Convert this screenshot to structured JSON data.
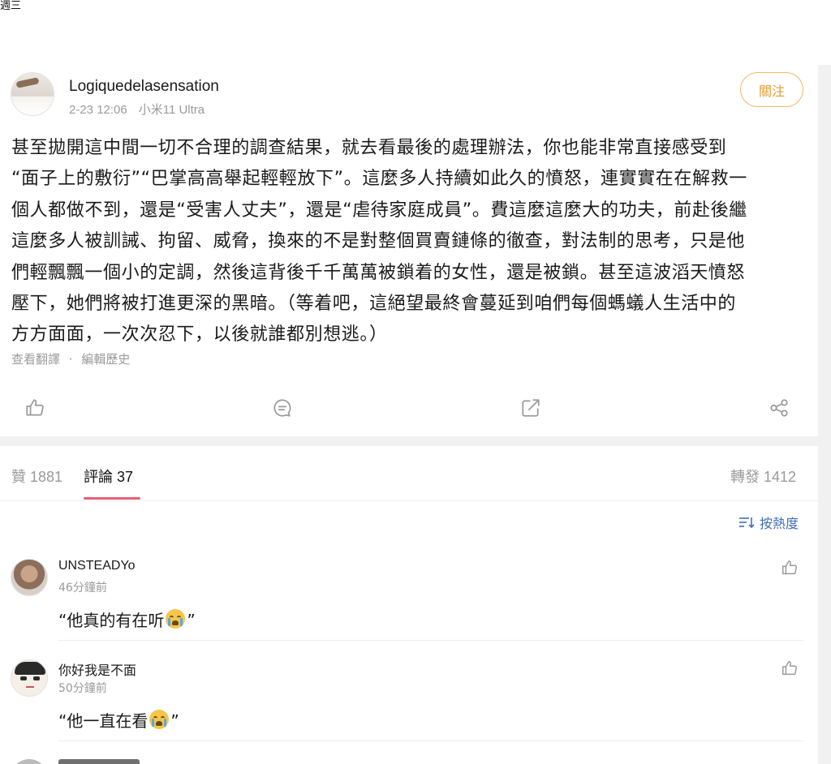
{
  "top": {
    "clipped_text": "週三"
  },
  "post": {
    "username": "Logiquedelasensation",
    "date": "2-23 12:06",
    "device": "小米11 Ultra",
    "follow_label": "關注",
    "text_lines": [
      "甚至拋開這中間一切不合理的調查結果，就去看最後的處理辦法，你也能非常直接感受到",
      "“面子上的敷衍”“巴掌高高舉起輕輕放下”。這麼多人持續如此久的憤怒，連實實在在解救一",
      "個人都做不到，還是“受害人丈夫”，還是“虐待家庭成員”。費這麼這麼大的功夫，前赴後繼",
      "這麼多人被訓誡、拘留、威脅，換來的不是對整個買賣鏈條的徹查，對法制的思考，只是他",
      "們輕飄飄一個小的定調，然後這背後千千萬萬被鎖着的女性，還是被鎖。甚至這波滔天憤怒",
      "壓下，她們將被打進更深的黑暗。（等着吧，這絕望最終會蔓延到咱們每個螞蟻人生活中的",
      "方方面面，一次次忍下，以後就誰都別想逃。）"
    ],
    "links": {
      "translate": "查看翻譯",
      "separator": "·",
      "edit_history": "編輯歷史"
    },
    "actions": [
      "like-icon",
      "comment-icon",
      "repost-icon",
      "share-icon"
    ]
  },
  "tabs": {
    "likes": {
      "label": "贊",
      "count": "1881"
    },
    "comments": {
      "label": "評論",
      "count": "37"
    },
    "reposts": {
      "label": "轉發",
      "count": "1412"
    },
    "sort_label": "按熱度"
  },
  "comments": [
    {
      "name": "UNSTEADYo",
      "time": "46分鐘前",
      "text_before": "“他真的有在听",
      "emoji": "crying-face",
      "text_after": "”"
    },
    {
      "name": "你好我是不面",
      "time": "50分鐘前",
      "text_before": "“他一直在看",
      "emoji": "crying-face",
      "text_after": "”"
    }
  ],
  "colors": {
    "accent_orange": "#e59a2f",
    "tab_underline": "#e86074",
    "link_blue": "#3f6fb6"
  }
}
